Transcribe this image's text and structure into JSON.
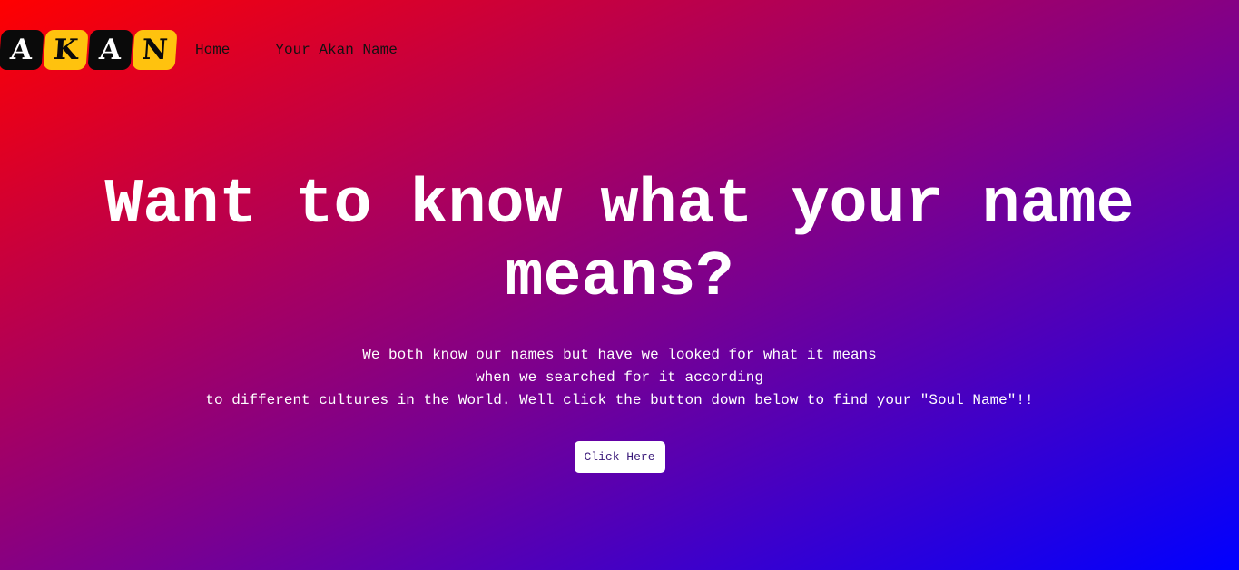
{
  "logo": {
    "letters": [
      "A",
      "K",
      "A",
      "N"
    ]
  },
  "nav": {
    "home_label": "Home",
    "akan_name_label": "Your Akan Name"
  },
  "hero": {
    "headline": "Want to know what your name means?",
    "paragraph_lines": [
      "We both know our names but have we looked for what it means",
      "when we searched for it according",
      "to different cultures in the World. Well click the button down below to find your \"Soul Name\"!!"
    ],
    "button_label": "Click Here"
  },
  "colors": {
    "gradient_start": "#ff0000",
    "gradient_end": "#0000ff",
    "logo_dark": "#0a0a0a",
    "logo_yellow": "#ffc20e"
  }
}
